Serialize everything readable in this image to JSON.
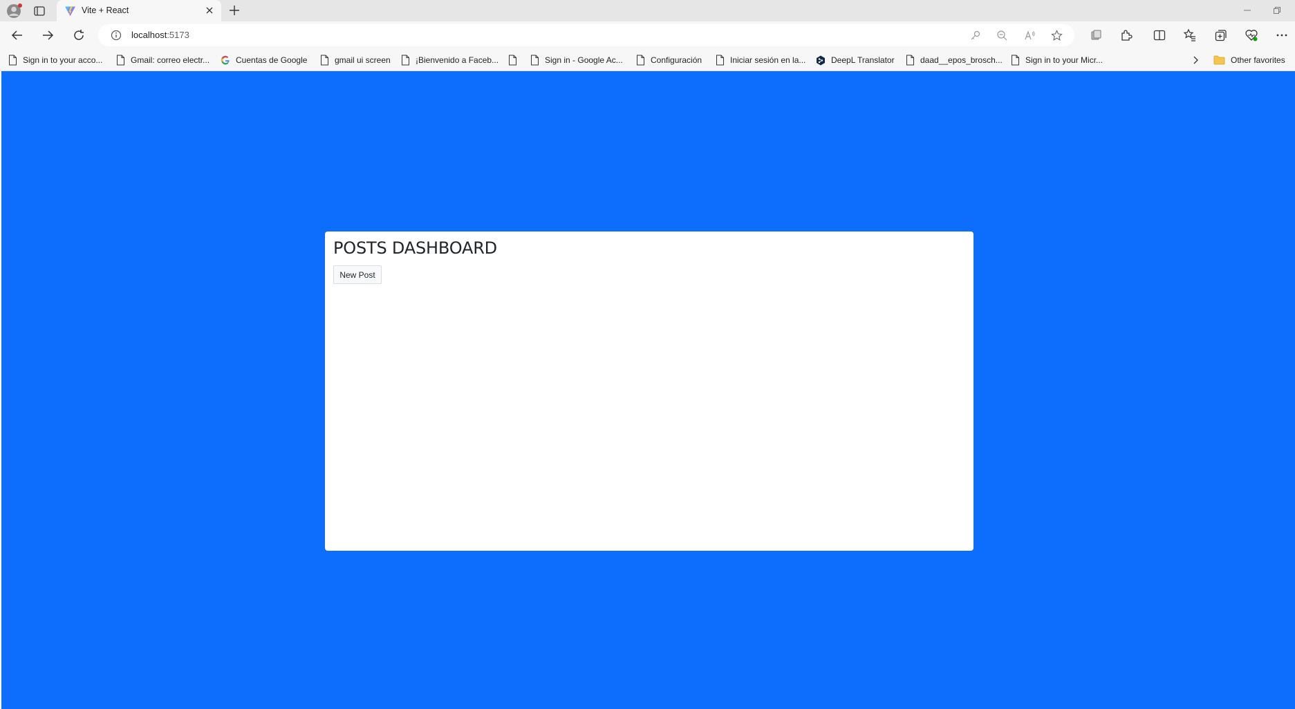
{
  "browser": {
    "tab": {
      "title": "Vite + React"
    },
    "address": {
      "host": "localhost",
      "port": ":5173"
    },
    "favorites": [
      {
        "label": "Sign in to your acco...",
        "icon": "page-icon"
      },
      {
        "label": "Gmail: correo electr...",
        "icon": "page-icon"
      },
      {
        "label": "Cuentas de Google",
        "icon": "google-icon"
      },
      {
        "label": "gmail ui screen",
        "icon": "page-icon"
      },
      {
        "label": "¡Bienvenido a Faceb...",
        "icon": "page-icon"
      },
      {
        "label": "",
        "icon": "page-icon"
      },
      {
        "label": "Sign in - Google Ac...",
        "icon": "page-icon"
      },
      {
        "label": "Configuración",
        "icon": "page-icon"
      },
      {
        "label": "Iniciar sesión en la...",
        "icon": "page-icon"
      },
      {
        "label": "DeepL Translator",
        "icon": "deepl-icon"
      },
      {
        "label": "daad__epos_brosch...",
        "icon": "page-icon"
      },
      {
        "label": "Sign in to your Micr...",
        "icon": "page-icon"
      }
    ],
    "other_favorites": "Other favorites"
  },
  "page": {
    "background_color": "#0d6efd",
    "title": "POSTS DASHBOARD",
    "new_post_label": "New Post"
  }
}
